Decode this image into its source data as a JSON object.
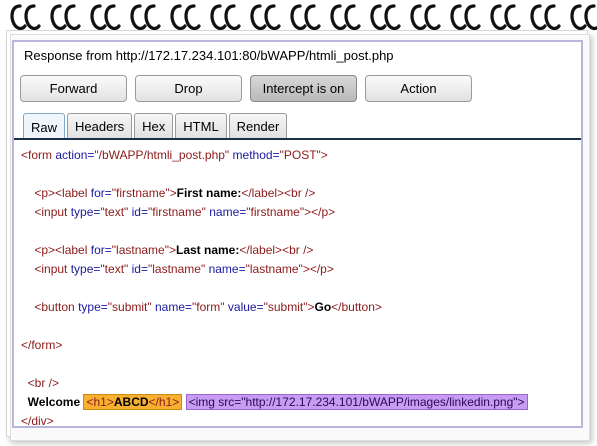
{
  "header": {
    "title": "Response from http://172.17.234.101:80/bWAPP/htmli_post.php"
  },
  "toolbar": {
    "forward_label": "Forward",
    "drop_label": "Drop",
    "intercept_label": "Intercept is on",
    "action_label": "Action"
  },
  "tabs": [
    {
      "label": "Raw",
      "active": true
    },
    {
      "label": "Headers"
    },
    {
      "label": "Hex"
    },
    {
      "label": "HTML"
    },
    {
      "label": "Render"
    }
  ],
  "code": {
    "form_open": {
      "action_val": "\"/bWAPP/htmli_post.php\"",
      "method_val": "\"POST\""
    },
    "firstname": {
      "for_val": "\"firstname\"",
      "label_text": "First name:",
      "type_val": "\"text\"",
      "id_val": "\"firstname\"",
      "name_val": "\"firstname\""
    },
    "lastname": {
      "for_val": "\"lastname\"",
      "label_text": "Last name:",
      "type_val": "\"text\"",
      "id_val": "\"lastname\"",
      "name_val": "\"lastname\""
    },
    "button": {
      "type_val": "\"submit\"",
      "name_val": "\"form\"",
      "value_val": "\"submit\"",
      "text": "Go"
    },
    "welcome": {
      "word": "Welcome",
      "h1_text": "ABCD",
      "img_src": "\"http://172.17.234.101/bWAPP/images/linkedin.png\""
    }
  },
  "colors": {
    "frame_border": "#b8b6dc",
    "tag": "#8b1a1a",
    "attribute": "#1a1aa0",
    "highlight_orange": "#f7b030",
    "highlight_purple": "#c79cf2"
  }
}
